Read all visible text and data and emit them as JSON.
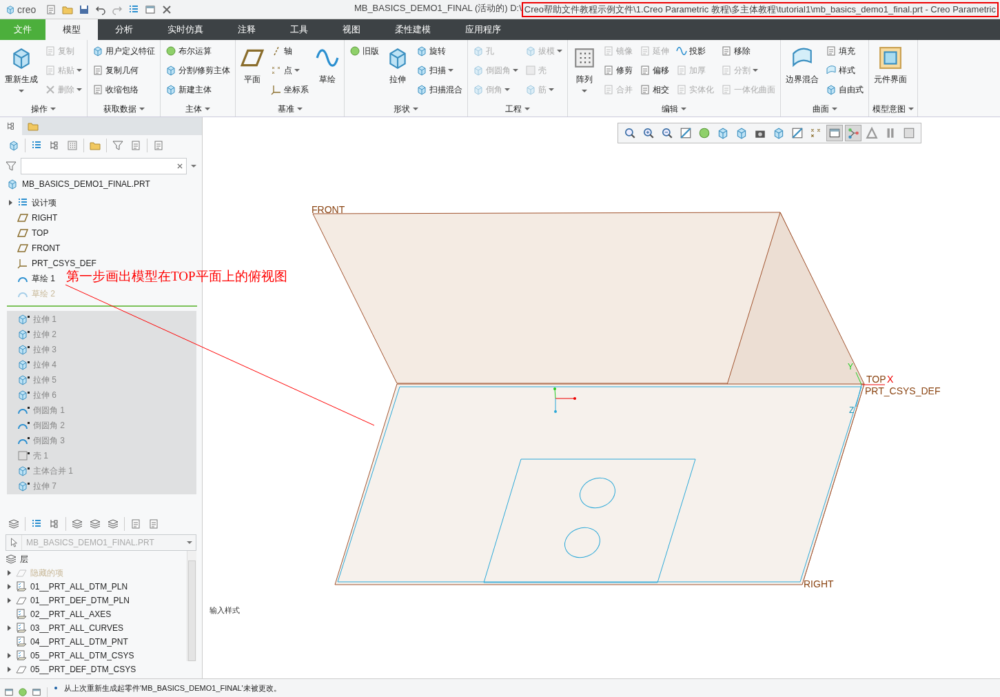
{
  "title_bar": {
    "app_name": "creo",
    "title": "MB_BASICS_DEMO1_FINAL (活动的) D:\\",
    "title_highlighted": "Creo帮助文件教程示例文件\\1.Creo Parametric 教程\\多主体教程\\tutorial1\\mb_basics_demo1_final.prt - Creo Parametric"
  },
  "menu_tabs": [
    {
      "label": "文件",
      "kind": "file",
      "selected": false
    },
    {
      "label": "模型",
      "kind": "tab",
      "selected": true
    },
    {
      "label": "分析",
      "kind": "tab",
      "selected": false
    },
    {
      "label": "实时仿真",
      "kind": "tab",
      "selected": false
    },
    {
      "label": "注释",
      "kind": "tab",
      "selected": false
    },
    {
      "label": "工具",
      "kind": "tab",
      "selected": false
    },
    {
      "label": "视图",
      "kind": "tab",
      "selected": false
    },
    {
      "label": "柔性建模",
      "kind": "tab",
      "selected": false
    },
    {
      "label": "应用程序",
      "kind": "tab",
      "selected": false
    }
  ],
  "ribbon": {
    "groups": [
      {
        "label": "操作",
        "columns": [
          [
            {
              "label": "重新生成",
              "kind": "large",
              "dropdown": true,
              "disabled": false
            }
          ],
          [
            {
              "label": "复制",
              "kind": "small",
              "dropdown": false,
              "disabled": true
            },
            {
              "label": "粘贴",
              "kind": "small",
              "dropdown": true,
              "disabled": true
            },
            {
              "label": "删除",
              "kind": "small",
              "dropdown": true,
              "disabled": true
            }
          ]
        ]
      },
      {
        "label": "获取数据",
        "columns": [
          [
            {
              "label": "用户定义特征",
              "kind": "small",
              "dropdown": false,
              "disabled": false
            },
            {
              "label": "复制几何",
              "kind": "small",
              "dropdown": false,
              "disabled": false
            },
            {
              "label": "收缩包络",
              "kind": "small",
              "dropdown": false,
              "disabled": false
            }
          ]
        ]
      },
      {
        "label": "主体",
        "columns": [
          [
            {
              "label": "布尔运算",
              "kind": "small",
              "dropdown": false,
              "disabled": false
            },
            {
              "label": "分割/修剪主体",
              "kind": "small",
              "dropdown": false,
              "disabled": false
            },
            {
              "label": "新建主体",
              "kind": "small",
              "dropdown": false,
              "disabled": false
            }
          ]
        ]
      },
      {
        "label": "基准",
        "columns": [
          [
            {
              "label": "平面",
              "kind": "large",
              "dropdown": false,
              "disabled": false
            }
          ],
          [
            {
              "label": "轴",
              "kind": "small",
              "dropdown": false,
              "disabled": false
            },
            {
              "label": "点",
              "kind": "small",
              "dropdown": true,
              "disabled": false
            },
            {
              "label": "坐标系",
              "kind": "small",
              "dropdown": false,
              "disabled": false
            }
          ],
          [
            {
              "label": "草绘",
              "kind": "large",
              "dropdown": false,
              "disabled": false
            }
          ]
        ]
      },
      {
        "label": "形状",
        "columns": [
          [
            {
              "label": "旧版",
              "kind": "small",
              "dropdown": false,
              "disabled": false
            }
          ],
          [
            {
              "label": "拉伸",
              "kind": "large",
              "dropdown": false,
              "disabled": false
            }
          ],
          [
            {
              "label": "旋转",
              "kind": "small",
              "dropdown": false,
              "disabled": false
            },
            {
              "label": "扫描",
              "kind": "small",
              "dropdown": true,
              "disabled": false
            },
            {
              "label": "扫描混合",
              "kind": "small",
              "dropdown": false,
              "disabled": false
            }
          ]
        ]
      },
      {
        "label": "工程",
        "columns": [
          [
            {
              "label": "孔",
              "kind": "small",
              "dropdown": false,
              "disabled": true
            },
            {
              "label": "倒圆角",
              "kind": "small",
              "dropdown": true,
              "disabled": true
            },
            {
              "label": "倒角",
              "kind": "small",
              "dropdown": true,
              "disabled": true
            }
          ],
          [
            {
              "label": "拔模",
              "kind": "small",
              "dropdown": true,
              "disabled": true
            },
            {
              "label": "壳",
              "kind": "small",
              "dropdown": false,
              "disabled": true
            },
            {
              "label": "筋",
              "kind": "small",
              "dropdown": true,
              "disabled": true
            }
          ]
        ]
      },
      {
        "label": "编辑",
        "columns": [
          [
            {
              "label": "阵列",
              "kind": "large",
              "dropdown": true,
              "disabled": false
            }
          ],
          [
            {
              "label": "镜像",
              "kind": "small",
              "dropdown": false,
              "disabled": true
            },
            {
              "label": "修剪",
              "kind": "small",
              "dropdown": false,
              "disabled": false
            },
            {
              "label": "合并",
              "kind": "small",
              "dropdown": false,
              "disabled": true
            }
          ],
          [
            {
              "label": "延伸",
              "kind": "small",
              "dropdown": false,
              "disabled": true
            },
            {
              "label": "偏移",
              "kind": "small",
              "dropdown": false,
              "disabled": false
            },
            {
              "label": "相交",
              "kind": "small",
              "dropdown": false,
              "disabled": false
            }
          ],
          [
            {
              "label": "投影",
              "kind": "small",
              "dropdown": false,
              "disabled": false
            },
            {
              "label": "加厚",
              "kind": "small",
              "dropdown": false,
              "disabled": true
            },
            {
              "label": "实体化",
              "kind": "small",
              "dropdown": false,
              "disabled": true
            }
          ],
          [
            {
              "label": "移除",
              "kind": "small",
              "dropdown": false,
              "disabled": false
            },
            {
              "label": "分割",
              "kind": "small",
              "dropdown": true,
              "disabled": true
            },
            {
              "label": "一体化曲面",
              "kind": "small",
              "dropdown": false,
              "disabled": true
            }
          ]
        ]
      },
      {
        "label": "曲面",
        "columns": [
          [
            {
              "label": "边界混合",
              "kind": "large",
              "dropdown": false,
              "disabled": false
            }
          ],
          [
            {
              "label": "填充",
              "kind": "small",
              "dropdown": false,
              "disabled": false
            },
            {
              "label": "样式",
              "kind": "small",
              "dropdown": false,
              "disabled": false
            },
            {
              "label": "自由式",
              "kind": "small",
              "dropdown": false,
              "disabled": false
            }
          ]
        ]
      },
      {
        "label": "模型意图",
        "columns": [
          [
            {
              "label": "元件界面",
              "kind": "large",
              "dropdown": false,
              "disabled": false
            }
          ]
        ]
      }
    ]
  },
  "model_tree": {
    "root": "MB_BASICS_DEMO1_FINAL.PRT",
    "items": [
      {
        "label": "设计项",
        "kind": "folder",
        "expandable": true,
        "disabled": false
      },
      {
        "label": "RIGHT",
        "kind": "plane",
        "expandable": false,
        "disabled": false
      },
      {
        "label": "TOP",
        "kind": "plane",
        "expandable": false,
        "disabled": false
      },
      {
        "label": "FRONT",
        "kind": "plane",
        "expandable": false,
        "disabled": false
      },
      {
        "label": "PRT_CSYS_DEF",
        "kind": "csys",
        "expandable": false,
        "disabled": false
      },
      {
        "label": "草绘 1",
        "kind": "sketch",
        "expandable": false,
        "disabled": false
      },
      {
        "label": "草绘 2",
        "kind": "sketch",
        "expandable": false,
        "disabled": true
      }
    ],
    "after_insert": [
      {
        "label": "拉伸 1",
        "kind": "extrude"
      },
      {
        "label": "拉伸 2",
        "kind": "extrude"
      },
      {
        "label": "拉伸 3",
        "kind": "extrude"
      },
      {
        "label": "拉伸 4",
        "kind": "extrude"
      },
      {
        "label": "拉伸 5",
        "kind": "extrude"
      },
      {
        "label": "拉伸 6",
        "kind": "extrude"
      },
      {
        "label": "倒圆角 1",
        "kind": "round"
      },
      {
        "label": "倒圆角 2",
        "kind": "round"
      },
      {
        "label": "倒圆角 3",
        "kind": "round"
      },
      {
        "label": "壳 1",
        "kind": "shell"
      },
      {
        "label": "主体合并 1",
        "kind": "extrude"
      },
      {
        "label": "拉伸 7",
        "kind": "extrude"
      }
    ]
  },
  "layer_tree": {
    "model": "MB_BASICS_DEMO1_FINAL.PRT",
    "root": "层",
    "items": [
      {
        "label": "隐藏的项",
        "kind": "plain",
        "expandable": true,
        "disabled": true
      },
      {
        "label": "01__PRT_ALL_DTM_PLN",
        "kind": "layer",
        "expandable": true,
        "disabled": false
      },
      {
        "label": "01__PRT_DEF_DTM_PLN",
        "kind": "plain",
        "expandable": true,
        "disabled": false
      },
      {
        "label": "02__PRT_ALL_AXES",
        "kind": "layer",
        "expandable": false,
        "disabled": false
      },
      {
        "label": "03__PRT_ALL_CURVES",
        "kind": "layer",
        "expandable": true,
        "disabled": false
      },
      {
        "label": "04__PRT_ALL_DTM_PNT",
        "kind": "layer",
        "expandable": false,
        "disabled": false
      },
      {
        "label": "05__PRT_ALL_DTM_CSYS",
        "kind": "layer",
        "expandable": true,
        "disabled": false
      },
      {
        "label": "05__PRT_DEF_DTM_CSYS",
        "kind": "plain",
        "expandable": true,
        "disabled": false
      }
    ]
  },
  "graphics": {
    "labels": [
      {
        "text": "FRONT",
        "kind": "plane"
      },
      {
        "text": "TOP",
        "kind": "plane"
      },
      {
        "text": "X",
        "kind": "x_axis"
      },
      {
        "text": "Y",
        "kind": "y_axis"
      },
      {
        "text": "Z",
        "kind": "z_axis"
      },
      {
        "text": "PRT_CSYS_DEF",
        "kind": "csys"
      },
      {
        "text": "RIGHT",
        "kind": "plane"
      }
    ],
    "corner_text": "输入样式"
  },
  "annotation": {
    "note": "第一步画出模型在TOP平面上的俯视图"
  },
  "status_bar": {
    "message": "从上次重新生成起零件'MB_BASICS_DEMO1_FINAL'未被更改。"
  }
}
